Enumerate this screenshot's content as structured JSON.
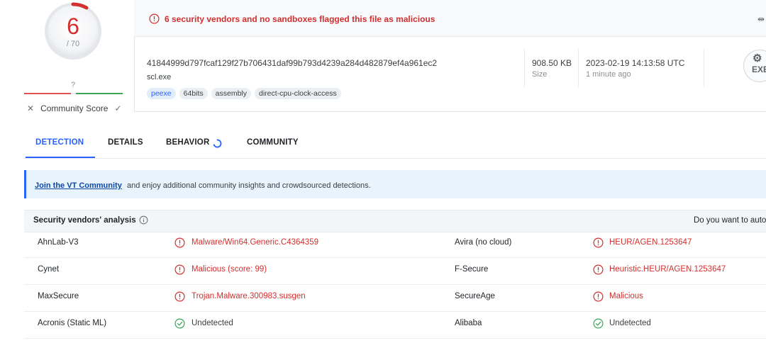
{
  "score": {
    "detections": "6",
    "total": "/ 70",
    "community_value": "?",
    "community_label": "Community Score"
  },
  "alert": {
    "text": "6 security vendors and no sandboxes flagged this file as malicious"
  },
  "file": {
    "hash": "41844999d797fcaf129f27b706431daf99b793d4239a284d482879ef4a961ec2",
    "name": "scl.exe",
    "tags": [
      "peexe",
      "64bits",
      "assembly",
      "direct-cpu-clock-access"
    ],
    "size_value": "908.50 KB",
    "size_label": "Size",
    "date_value": "2023-02-19 14:13:58 UTC",
    "date_label": "1 minute ago",
    "type_badge": "EXE"
  },
  "tabs": [
    {
      "label": "DETECTION"
    },
    {
      "label": "DETAILS"
    },
    {
      "label": "BEHAVIOR"
    },
    {
      "label": "COMMUNITY"
    }
  ],
  "banner": {
    "link": "Join the VT Community",
    "text": "and enjoy additional community insights and crowdsourced detections."
  },
  "table": {
    "title": "Security vendors' analysis",
    "right_text": "Do you want to auto",
    "rows": [
      {
        "v1": "AhnLab-V3",
        "r1": "Malware/Win64.Generic.C4364359",
        "s1": "bad",
        "v2": "Avira (no cloud)",
        "r2": "HEUR/AGEN.1253647",
        "s2": "bad"
      },
      {
        "v1": "Cynet",
        "r1": "Malicious (score: 99)",
        "s1": "bad",
        "v2": "F-Secure",
        "r2": "Heuristic.HEUR/AGEN.1253647",
        "s2": "bad"
      },
      {
        "v1": "MaxSecure",
        "r1": "Trojan.Malware.300983.susgen",
        "s1": "bad",
        "v2": "SecureAge",
        "r2": "Malicious",
        "s2": "bad"
      },
      {
        "v1": "Acronis (Static ML)",
        "r1": "Undetected",
        "s1": "good",
        "v2": "Alibaba",
        "r2": "Undetected",
        "s2": "good"
      }
    ]
  },
  "colors": {
    "malicious": "#d32f2f",
    "accent": "#2962ff",
    "clean": "#3aa757"
  }
}
